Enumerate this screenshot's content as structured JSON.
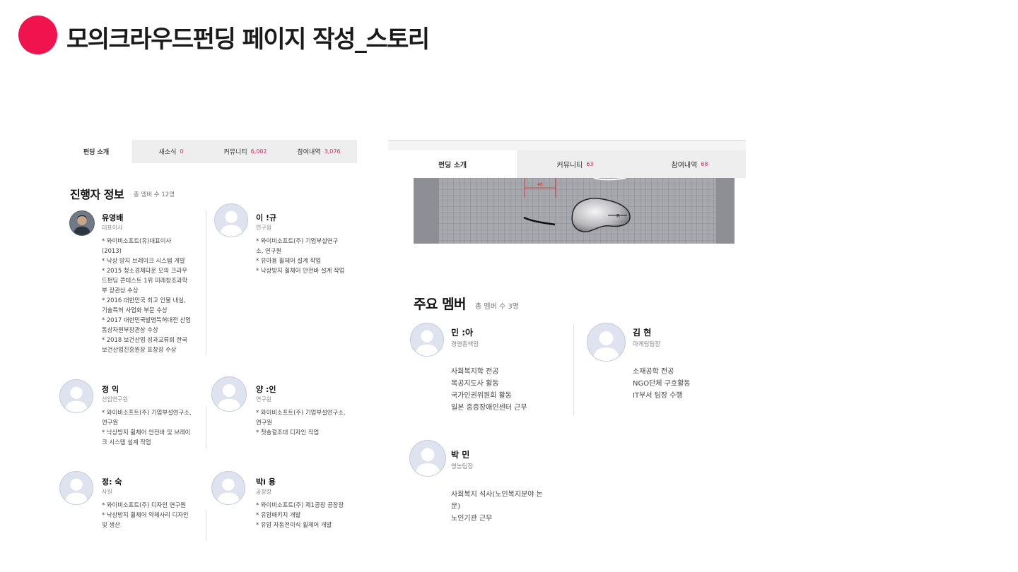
{
  "title": "모의크라우드펀딩 페이지 작성_스토리",
  "accent_color": "#f0134d",
  "left_panel": {
    "tabs": [
      {
        "label": "펀딩 소개",
        "count": ""
      },
      {
        "label": "새소식",
        "count": "0"
      },
      {
        "label": "커뮤니티",
        "count": "6,002"
      },
      {
        "label": "참여내역",
        "count": "3,076"
      }
    ],
    "section_title": "진행자 정보",
    "section_sub": "총 멤버 수 12명",
    "members": [
      {
        "name": "유영배",
        "role": "대표이사",
        "desc": [
          "* 와이비소프트(유)대표이사 (2013)",
          "* 낙상 방지 브레이크 시스템 개발",
          "* 2015 청소경제타운 모의 크라우드펀딩 콘테스트 1위 미래창조과학부 장관상 수상",
          "* 2016 대한민국 최고 인물 내실, 기술특허 사업화 부문 수상",
          "* 2017 대한민국발명특허대전 산업통상자원부장관상 수상",
          "* 2018 보건산업 성과교류회 한국보건산업진흥원장 표창장 수상"
        ]
      },
      {
        "name": "이 !규",
        "role": "연구원",
        "desc": [
          "* 와이비소프트(주) 기업부설연구소, 연구원",
          "* 유아용 휠체어 설계 작업",
          "* 낙상방지 휠체어 안전바 설계 작업"
        ]
      },
      {
        "name": "정 익",
        "role": "선임연구원",
        "desc": [
          "* 와이비소프트(주) 기업부설연구소, 연구원",
          "* 낙상방지 휠체어 안전바 및 브레이크 시스템 설계 작업"
        ]
      },
      {
        "name": "양 :인",
        "role": "연구원",
        "desc": [
          "* 와이비소프트(주) 기업부설연구소, 연구원",
          "* 첫솔걸조대 디자인 작업"
        ]
      },
      {
        "name": "정: 숙",
        "role": "사원",
        "desc": [
          "* 와이비소프트(주) 디자인 연구원",
          "* 낙상방지 휠체어 약체사리 디자인 및 생산"
        ]
      },
      {
        "name": "박i 용",
        "role": "공장장",
        "desc": [
          "* 와이비소프트(주) 제1공장 공장장",
          "* 유압패키지 개발",
          "* 유압 자동전이식 휠체어 개발"
        ]
      }
    ]
  },
  "right_panel": {
    "tabs": [
      {
        "label": "펀딩 소개",
        "count": ""
      },
      {
        "label": "커뮤니티",
        "count": "63"
      },
      {
        "label": "참여내역",
        "count": "68"
      }
    ],
    "cad_dimension": "40",
    "cad_label": "R",
    "section_title": "주요 멤버",
    "section_sub": "총 멤버 수 3명",
    "members": [
      {
        "name": "민 :아",
        "role": "경영총책임",
        "desc": [
          "사회복지학 전공",
          "목공지도사 활동",
          "국가인권위원회 활동",
          "일본 중증장애인센터 근무"
        ]
      },
      {
        "name": "김 현",
        "role": "마케팅팀장",
        "desc": [
          "소재공학 전공",
          "NGO단체 구호활동",
          "IT부서 팀장 수행"
        ]
      },
      {
        "name": "박 민",
        "role": "영농팀장",
        "desc": [
          "사회복지 석사(노인복지분야 논문)",
          "노인기관 근무"
        ]
      }
    ]
  }
}
